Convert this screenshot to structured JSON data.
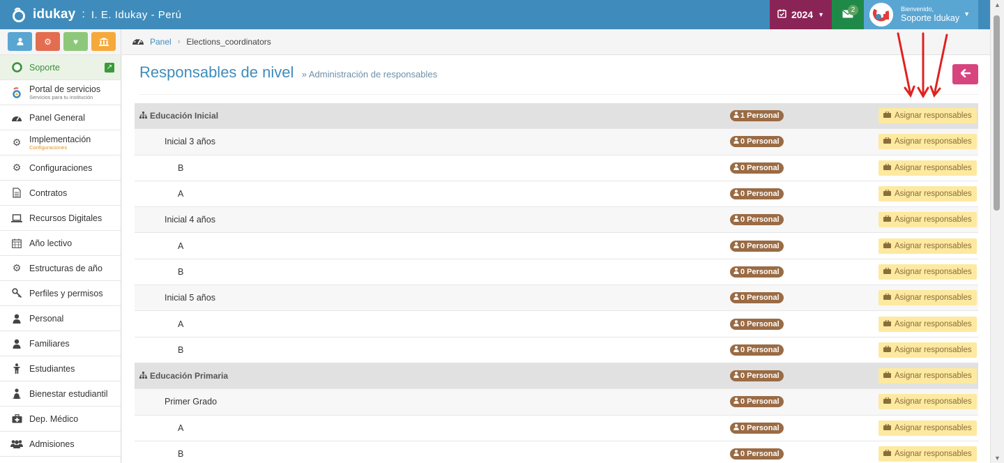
{
  "app": {
    "brand": "idukay",
    "separator": ":",
    "school": "I. E. Idukay - Perú"
  },
  "topbar": {
    "year": "2024",
    "messages_count": "2",
    "greeting": "Bienvenido,",
    "user_name": "Soporte Idukay"
  },
  "sidebar": {
    "shortcut_colors": [
      "#5aa6d3",
      "#e36d50",
      "#8dc87a",
      "#f6a93b"
    ],
    "items": [
      {
        "label": "Soporte",
        "icon": "lifebuoy-icon",
        "active": true
      },
      {
        "label": "Portal de servicios",
        "sub": "Servicios para tu institución",
        "icon": "idukay-logo-icon"
      },
      {
        "label": "Panel General",
        "icon": "dashboard-icon"
      },
      {
        "label": "Implementación",
        "sub": "Configuraciones",
        "icon": "gears-icon"
      },
      {
        "label": "Configuraciones",
        "icon": "gears-icon"
      },
      {
        "label": "Contratos",
        "icon": "document-icon"
      },
      {
        "label": "Recursos Digitales",
        "icon": "laptop-icon"
      },
      {
        "label": "Año lectivo",
        "icon": "calendar-icon"
      },
      {
        "label": "Estructuras de año",
        "icon": "gear-icon"
      },
      {
        "label": "Perfiles y permisos",
        "icon": "key-icon"
      },
      {
        "label": "Personal",
        "icon": "user-icon"
      },
      {
        "label": "Familiares",
        "icon": "user-icon"
      },
      {
        "label": "Estudiantes",
        "icon": "child-icon"
      },
      {
        "label": "Bienestar estudiantil",
        "icon": "student-icon"
      },
      {
        "label": "Dep. Médico",
        "icon": "medkit-icon"
      },
      {
        "label": "Admisiones",
        "icon": "users-icon"
      }
    ]
  },
  "breadcrumb": {
    "home": "Panel",
    "current": "Elections_coordinators"
  },
  "page": {
    "title": "Responsables de nivel",
    "subtitle": "» Administración de responsables"
  },
  "rows": [
    {
      "level": 0,
      "name": "Educación Inicial",
      "count": "1 Personal",
      "action": "Asignar responsables"
    },
    {
      "level": 1,
      "name": "Inicial 3 años",
      "count": "0 Personal",
      "action": "Asignar responsables"
    },
    {
      "level": 2,
      "name": "B",
      "count": "0 Personal",
      "action": "Asignar responsables"
    },
    {
      "level": 2,
      "name": "A",
      "count": "0 Personal",
      "action": "Asignar responsables"
    },
    {
      "level": 1,
      "name": "Inicial 4 años",
      "count": "0 Personal",
      "action": "Asignar responsables"
    },
    {
      "level": 2,
      "name": "A",
      "count": "0 Personal",
      "action": "Asignar responsables"
    },
    {
      "level": 2,
      "name": "B",
      "count": "0 Personal",
      "action": "Asignar responsables"
    },
    {
      "level": 1,
      "name": "Inicial 5 años",
      "count": "0 Personal",
      "action": "Asignar responsables"
    },
    {
      "level": 2,
      "name": "A",
      "count": "0 Personal",
      "action": "Asignar responsables"
    },
    {
      "level": 2,
      "name": "B",
      "count": "0 Personal",
      "action": "Asignar responsables"
    },
    {
      "level": 0,
      "name": "Educación Primaria",
      "count": "0 Personal",
      "action": "Asignar responsables"
    },
    {
      "level": 1,
      "name": "Primer Grado",
      "count": "0 Personal",
      "action": "Asignar responsables"
    },
    {
      "level": 2,
      "name": "A",
      "count": "0 Personal",
      "action": "Asignar responsables"
    },
    {
      "level": 2,
      "name": "B",
      "count": "0 Personal",
      "action": "Asignar responsables"
    }
  ]
}
